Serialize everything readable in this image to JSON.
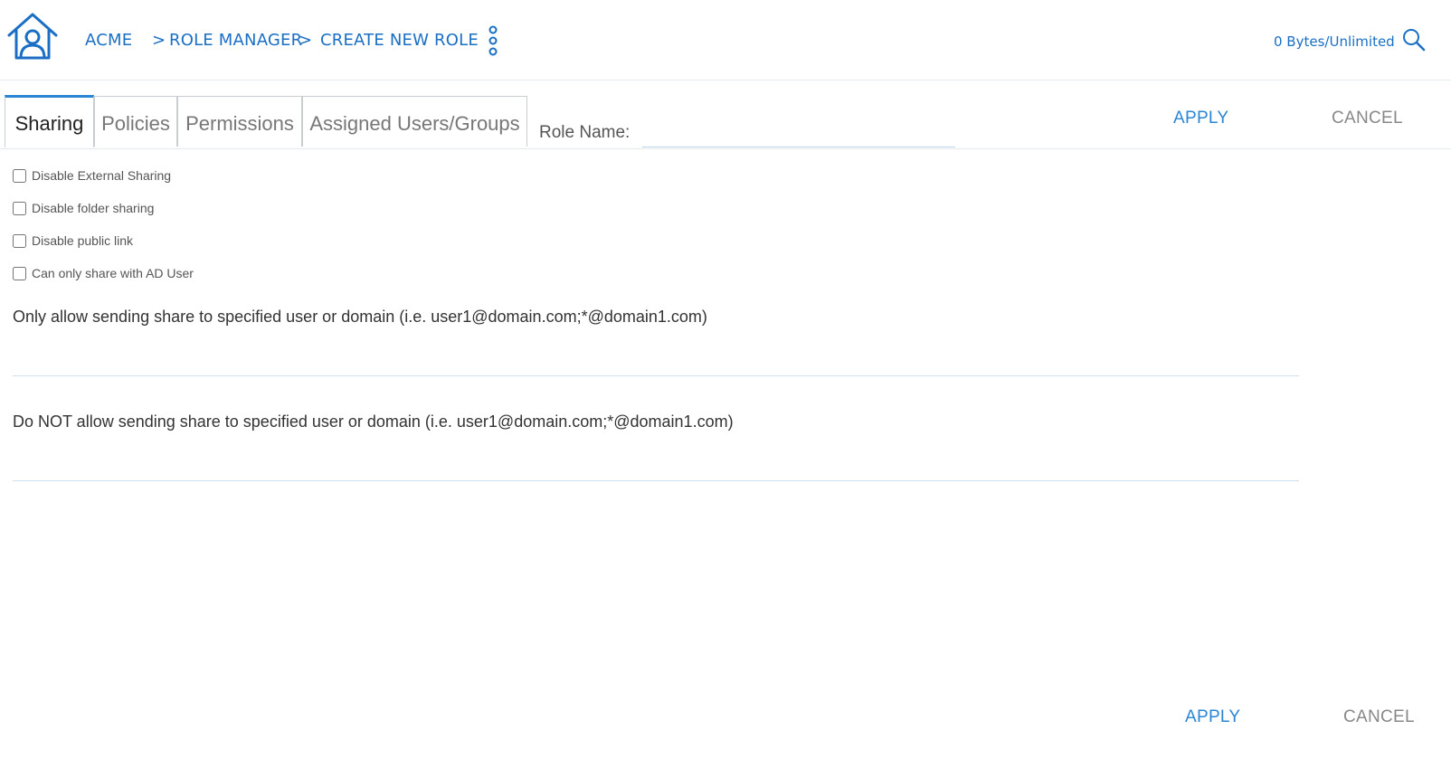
{
  "header": {
    "breadcrumb": {
      "home": "ACME",
      "sep1": ">",
      "role_manager": "ROLE MANAGER",
      "sep2": ">",
      "current": "CREATE NEW ROLE"
    },
    "storage_used": "0 Bytes",
    "storage_sep": "/",
    "storage_limit": "Unlimited",
    "icons": [
      "home-icon",
      "more-vertical-icon",
      "search-icon"
    ]
  },
  "tabs": [
    {
      "label": "Sharing",
      "active": true
    },
    {
      "label": "Policies",
      "active": false
    },
    {
      "label": "Permissions",
      "active": false
    },
    {
      "label": "Assigned Users/Groups",
      "active": false
    }
  ],
  "role_name": {
    "label": "Role Name:",
    "value": ""
  },
  "actions": {
    "apply": "APPLY",
    "cancel": "CANCEL"
  },
  "sharing_options": [
    {
      "label": "Disable External Sharing",
      "checked": false
    },
    {
      "label": "Disable folder sharing",
      "checked": false
    },
    {
      "label": "Disable public link",
      "checked": false
    },
    {
      "label": "Can only share with AD User",
      "checked": false
    }
  ],
  "allow_field": {
    "label": "Only allow sending share to specified user or domain (i.e. user1@domain.com;*@domain1.com)",
    "value": ""
  },
  "deny_field": {
    "label": "Do NOT allow sending share to specified user or domain (i.e. user1@domain.com;*@domain1.com)",
    "value": ""
  },
  "colors": {
    "accent": "#2a86d4",
    "link": "#1a6fc4",
    "muted": "#888888"
  }
}
